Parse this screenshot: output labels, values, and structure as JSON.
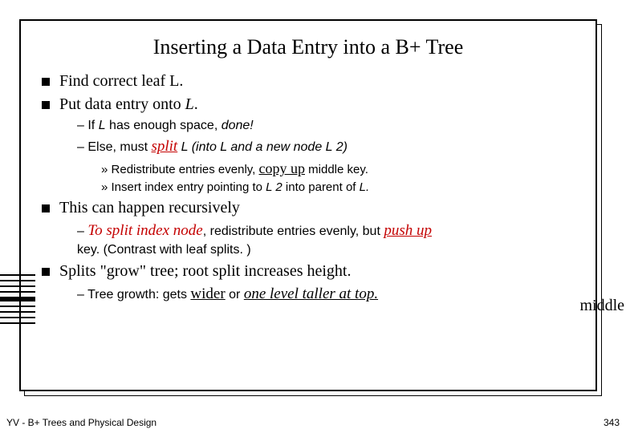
{
  "title": "Inserting a Data Entry into a B+ Tree",
  "bullets": {
    "b1": "Find correct leaf L.",
    "b2": "Put data entry onto ",
    "b2_it": "L",
    "b2_tail": ".",
    "d1a": "If ",
    "d1b": "L",
    "d1c": " has enough space, ",
    "d1d": "done!",
    "d2a": "Else, must ",
    "d2b": "split",
    "d2c": "  L (into L and a new node L 2)",
    "x1a": "Redistribute entries evenly, ",
    "x1b": "copy up",
    "x1c": " middle key.",
    "x2a": "Insert index entry pointing to ",
    "x2b": "L 2",
    "x2c": " into parent of ",
    "x2d": "L.",
    "b3": "This can happen recursively",
    "d3a": "To split index node",
    "d3b": ", redistribute entries evenly, but ",
    "d3c": "push up",
    "d3tail": "key.  (Contrast with leaf splits. )",
    "b4": "Splits \"grow\" tree; root split increases height.",
    "d4a": "Tree growth: gets ",
    "d4b": "wider",
    "d4c": " or ",
    "d4d": "one level taller at top."
  },
  "overflow": "middle",
  "footer_left": "YV  -  B+ Trees and Physical Design",
  "footer_right": "343"
}
